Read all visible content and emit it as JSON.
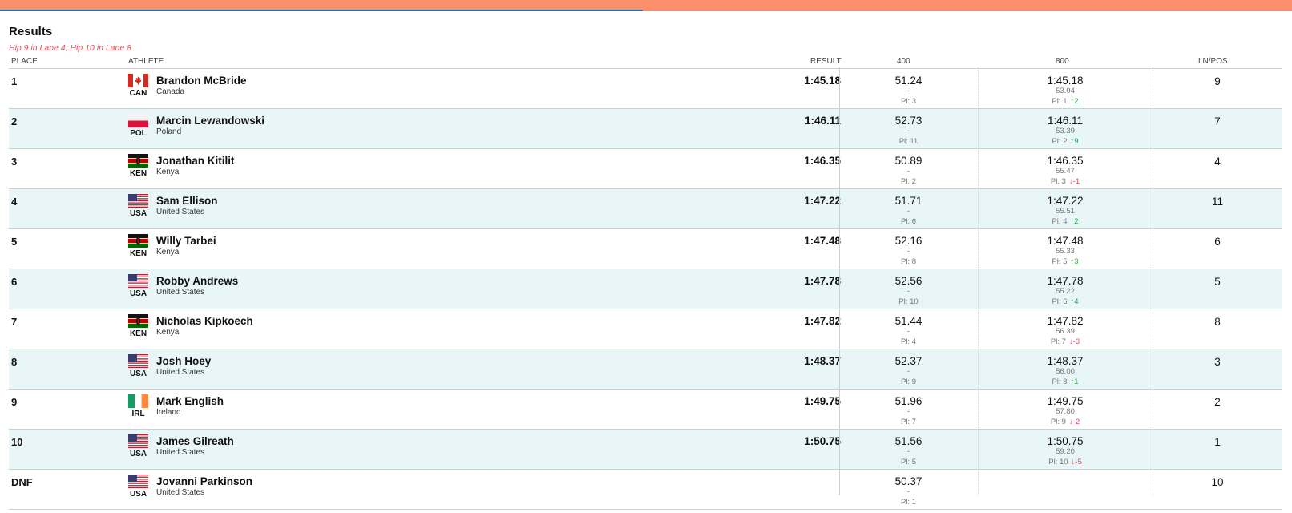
{
  "header": {
    "title": "Results",
    "note": "Hip 9 in Lane 4; Hip 10 in Lane 8"
  },
  "columns": {
    "place": "PLACE",
    "athlete": "ATHLETE",
    "result": "RESULT",
    "split400": "400",
    "split800": "800",
    "lnpos": "LN/POS"
  },
  "colors": {
    "accent_bar": "#fb8f6b",
    "progress": "#2f6fa8",
    "row_alt": "#e8f6f7",
    "note": "#e0505c",
    "gain": "#2ea84a",
    "loss": "#e0505c"
  },
  "rows": [
    {
      "place": "1",
      "code": "CAN",
      "flag": "canada-flag-icon",
      "name": "Brandon McBride",
      "country": "Canada",
      "result": "1:45.18",
      "s400": {
        "time": "51.24",
        "lap": "-",
        "pl": "Pl: 3",
        "chg": "",
        "dir": ""
      },
      "s800": {
        "time": "1:45.18",
        "lap": "53.94",
        "pl": "Pl: 1",
        "chg": "↑2",
        "dir": "up"
      },
      "lnpos": "9"
    },
    {
      "place": "2",
      "code": "POL",
      "flag": "poland-flag-icon",
      "name": "Marcin Lewandowski",
      "country": "Poland",
      "result": "1:46.11",
      "s400": {
        "time": "52.73",
        "lap": "-",
        "pl": "Pl: 11",
        "chg": "",
        "dir": ""
      },
      "s800": {
        "time": "1:46.11",
        "lap": "53.39",
        "pl": "Pl: 2",
        "chg": "↑9",
        "dir": "up"
      },
      "lnpos": "7"
    },
    {
      "place": "3",
      "code": "KEN",
      "flag": "kenya-flag-icon",
      "name": "Jonathan Kitilit",
      "country": "Kenya",
      "result": "1:46.35",
      "s400": {
        "time": "50.89",
        "lap": "-",
        "pl": "Pl: 2",
        "chg": "",
        "dir": ""
      },
      "s800": {
        "time": "1:46.35",
        "lap": "55.47",
        "pl": "Pl: 3",
        "chg": "↓-1",
        "dir": "down"
      },
      "lnpos": "4"
    },
    {
      "place": "4",
      "code": "USA",
      "flag": "usa-flag-icon",
      "name": "Sam Ellison",
      "country": "United States",
      "result": "1:47.22",
      "s400": {
        "time": "51.71",
        "lap": "-",
        "pl": "Pl: 6",
        "chg": "",
        "dir": ""
      },
      "s800": {
        "time": "1:47.22",
        "lap": "55.51",
        "pl": "Pl: 4",
        "chg": "↑2",
        "dir": "up"
      },
      "lnpos": "11"
    },
    {
      "place": "5",
      "code": "KEN",
      "flag": "kenya-flag-icon",
      "name": "Willy Tarbei",
      "country": "Kenya",
      "result": "1:47.48",
      "s400": {
        "time": "52.16",
        "lap": "-",
        "pl": "Pl: 8",
        "chg": "",
        "dir": ""
      },
      "s800": {
        "time": "1:47.48",
        "lap": "55.33",
        "pl": "Pl: 5",
        "chg": "↑3",
        "dir": "up"
      },
      "lnpos": "6"
    },
    {
      "place": "6",
      "code": "USA",
      "flag": "usa-flag-icon",
      "name": "Robby Andrews",
      "country": "United States",
      "result": "1:47.78",
      "s400": {
        "time": "52.56",
        "lap": "-",
        "pl": "Pl: 10",
        "chg": "",
        "dir": ""
      },
      "s800": {
        "time": "1:47.78",
        "lap": "55.22",
        "pl": "Pl: 6",
        "chg": "↑4",
        "dir": "up"
      },
      "lnpos": "5"
    },
    {
      "place": "7",
      "code": "KEN",
      "flag": "kenya-flag-icon",
      "name": "Nicholas Kipkoech",
      "country": "Kenya",
      "result": "1:47.82",
      "s400": {
        "time": "51.44",
        "lap": "-",
        "pl": "Pl: 4",
        "chg": "",
        "dir": ""
      },
      "s800": {
        "time": "1:47.82",
        "lap": "56.39",
        "pl": "Pl: 7",
        "chg": "↓-3",
        "dir": "down"
      },
      "lnpos": "8"
    },
    {
      "place": "8",
      "code": "USA",
      "flag": "usa-flag-icon",
      "name": "Josh Hoey",
      "country": "United States",
      "result": "1:48.37",
      "s400": {
        "time": "52.37",
        "lap": "-",
        "pl": "Pl: 9",
        "chg": "",
        "dir": ""
      },
      "s800": {
        "time": "1:48.37",
        "lap": "56.00",
        "pl": "Pl: 8",
        "chg": "↑1",
        "dir": "up"
      },
      "lnpos": "3"
    },
    {
      "place": "9",
      "code": "IRL",
      "flag": "ireland-flag-icon",
      "name": "Mark English",
      "country": "Ireland",
      "result": "1:49.75",
      "s400": {
        "time": "51.96",
        "lap": "-",
        "pl": "Pl: 7",
        "chg": "",
        "dir": ""
      },
      "s800": {
        "time": "1:49.75",
        "lap": "57.80",
        "pl": "Pl: 9",
        "chg": "↓-2",
        "dir": "down"
      },
      "lnpos": "2"
    },
    {
      "place": "10",
      "code": "USA",
      "flag": "usa-flag-icon",
      "name": "James Gilreath",
      "country": "United States",
      "result": "1:50.75",
      "s400": {
        "time": "51.56",
        "lap": "-",
        "pl": "Pl: 5",
        "chg": "",
        "dir": ""
      },
      "s800": {
        "time": "1:50.75",
        "lap": "59.20",
        "pl": "Pl: 10",
        "chg": "↓-5",
        "dir": "down"
      },
      "lnpos": "1"
    },
    {
      "place": "DNF",
      "code": "USA",
      "flag": "usa-flag-icon",
      "name": "Jovanni Parkinson",
      "country": "United States",
      "result": "",
      "s400": {
        "time": "50.37",
        "lap": "-",
        "pl": "Pl: 1",
        "chg": "",
        "dir": ""
      },
      "s800": {
        "time": "",
        "lap": "",
        "pl": "",
        "chg": "",
        "dir": ""
      },
      "lnpos": "10"
    }
  ]
}
